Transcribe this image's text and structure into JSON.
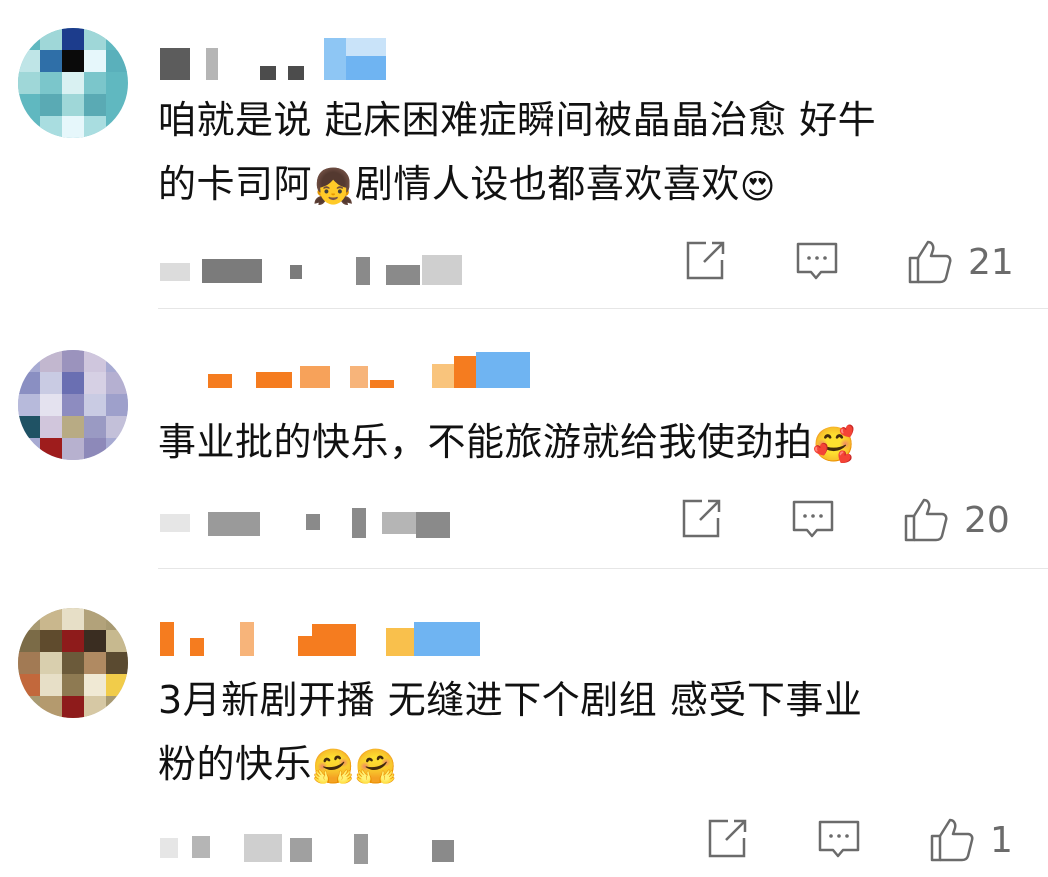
{
  "comments": [
    {
      "text": "咱就是说 起床困难症瞬间被晶晶治愈 好牛\n的卡司阿",
      "text_tail": "剧情人设也都喜欢喜欢",
      "emoji_inline": "👧",
      "emoji_end": "😍",
      "like_count": "21",
      "avatar_colors": [
        "#60b8c0",
        "#1c3c8c",
        "#9fd7d8",
        "#e6f7fb"
      ]
    },
    {
      "text": "事业批的快乐，不能旅游就给我使劲拍",
      "emoji_end": "🥰",
      "like_count": "20",
      "avatar_colors": [
        "#8a8fc2",
        "#c9cbe3",
        "#9e1c1c",
        "#1f5264"
      ]
    },
    {
      "text": "3月新剧开播 无缝进下个剧组 感受下事业\n粉的快乐",
      "emoji_end": "🤗🤗",
      "like_count": "1",
      "avatar_colors": [
        "#7b6b47",
        "#c9b78d",
        "#8e1b1b",
        "#e7dfc7"
      ]
    }
  ],
  "icons": {
    "share": "share-icon",
    "comment": "comment-icon",
    "like": "thumb-up-icon"
  },
  "colors": {
    "text": "#111111",
    "muted": "#6b6b6b",
    "name_orange": "#f57c1f",
    "name_blue": "#6fb4f2"
  }
}
